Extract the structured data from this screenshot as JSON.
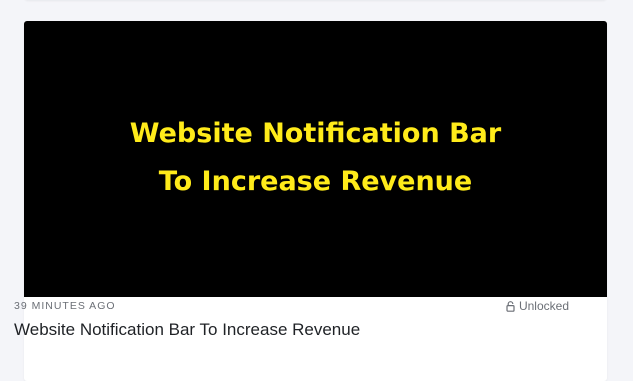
{
  "post": {
    "thumbnail_text_line1": "Website Notification Bar",
    "thumbnail_text_line2": "To Increase Revenue",
    "time_ago": "39 MINUTES AGO",
    "unlock_status": "Unlocked",
    "title": "Website Notification Bar To Increase Revenue",
    "unlock_icon": "lock-open-icon"
  },
  "colors": {
    "page_background": "#f4f5f9",
    "card_background": "#ffffff",
    "thumbnail_background": "#000000",
    "thumbnail_text": "#ffeb1a",
    "meta_text": "#6b6f76",
    "title_text": "#1f2226"
  }
}
